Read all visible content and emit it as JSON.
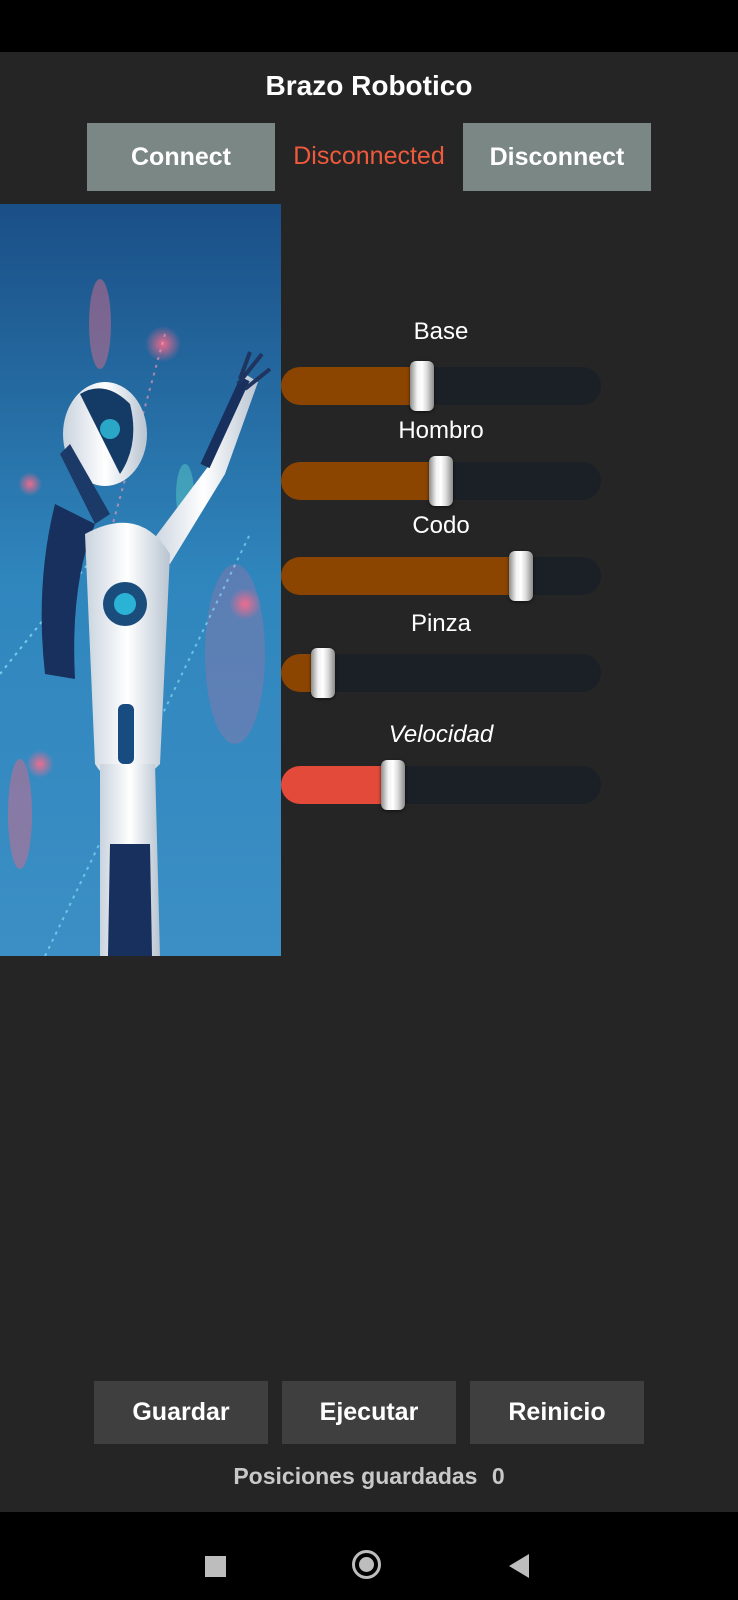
{
  "app": {
    "title": "Brazo Robotico",
    "connect_label": "Connect",
    "disconnect_label": "Disconnect",
    "status": "Disconnected"
  },
  "sliders": [
    {
      "label": "Base",
      "value": 0.44,
      "color": "#8b4500"
    },
    {
      "label": "Hombro",
      "value": 0.5,
      "color": "#8b4500"
    },
    {
      "label": "Codo",
      "value": 0.75,
      "color": "#8b4500"
    },
    {
      "label": "Pinza",
      "value": 0.13,
      "color": "#8b4500"
    },
    {
      "label": "Velocidad",
      "value": 0.35,
      "color": "#e34a3a"
    }
  ],
  "actions": {
    "save_label": "Guardar",
    "run_label": "Ejecutar",
    "reset_label": "Reinicio"
  },
  "saved_positions": {
    "label": "Posiciones guardadas",
    "count": "0"
  },
  "colors": {
    "background": "#252525",
    "button_top": "#7b8784",
    "button_bottom": "#3f3f3f",
    "status_text": "#f05a3c"
  },
  "navigation": {
    "recent_icon": "square-icon",
    "home_icon": "circle-home-icon",
    "back_icon": "triangle-back-icon"
  }
}
